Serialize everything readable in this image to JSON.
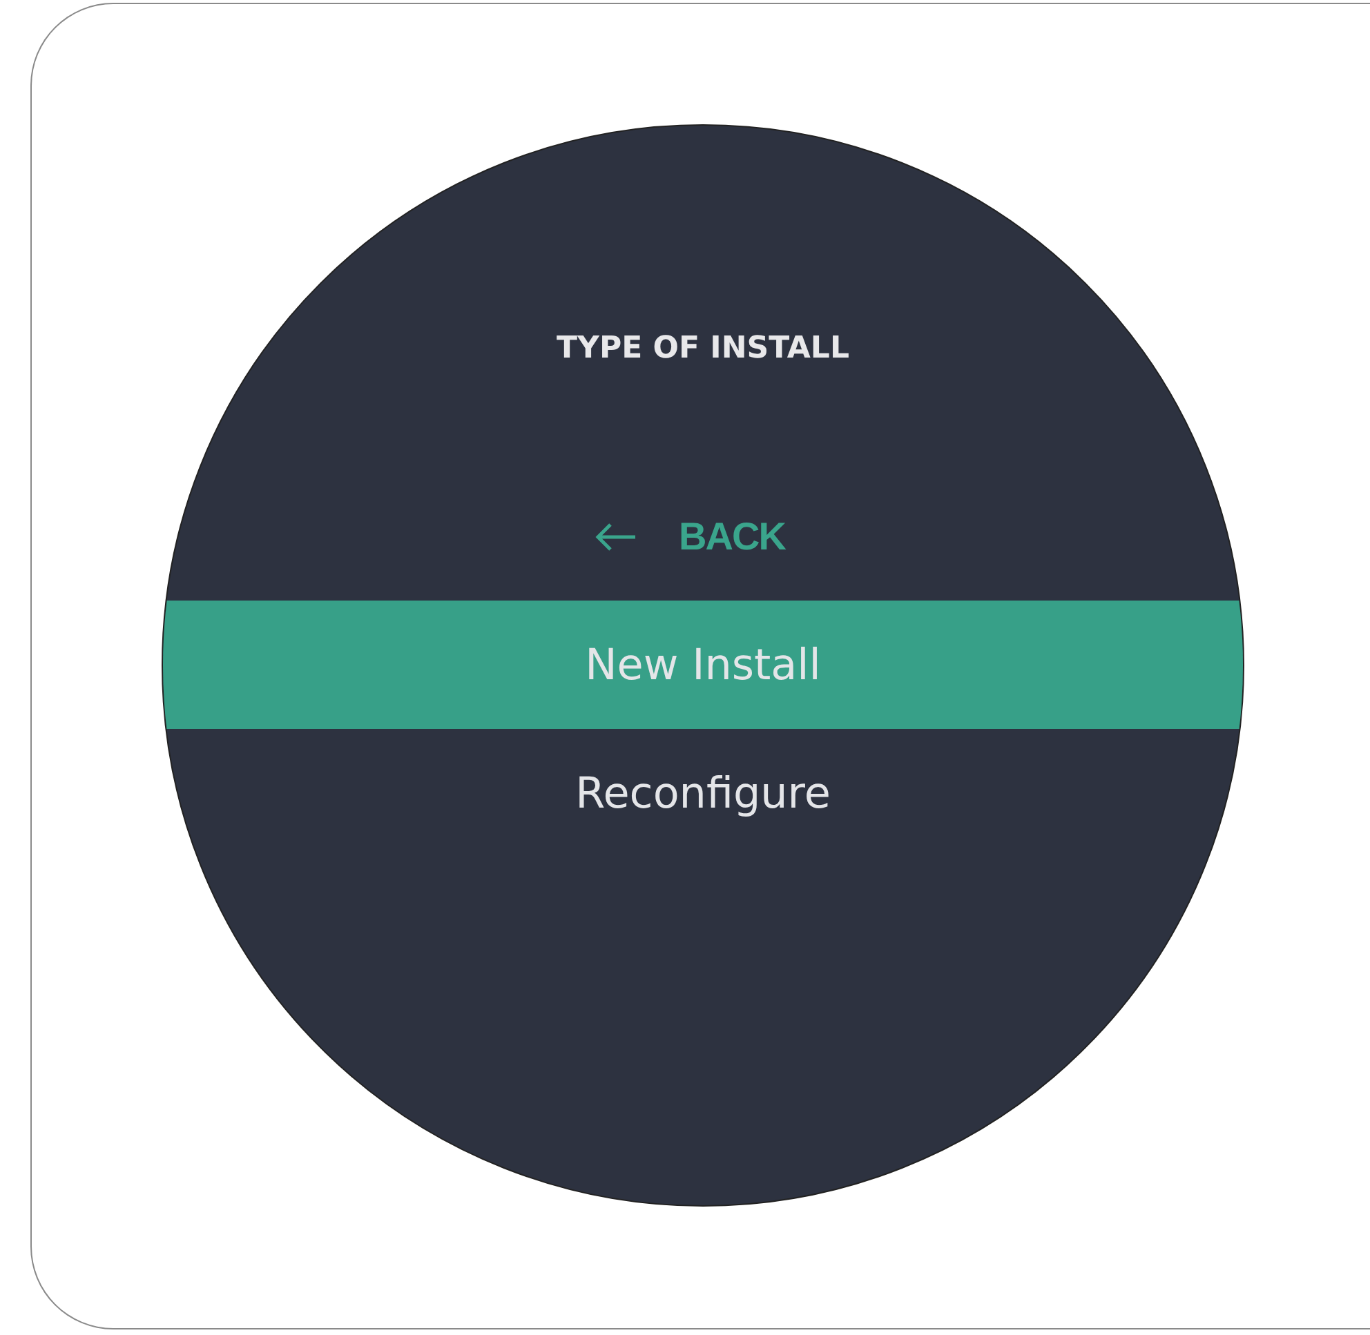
{
  "title": "TYPE OF INSTALL",
  "back": {
    "label": "BACK"
  },
  "menu": [
    {
      "label": "New Install",
      "selected": true
    },
    {
      "label": "Reconfigure",
      "selected": false
    }
  ]
}
